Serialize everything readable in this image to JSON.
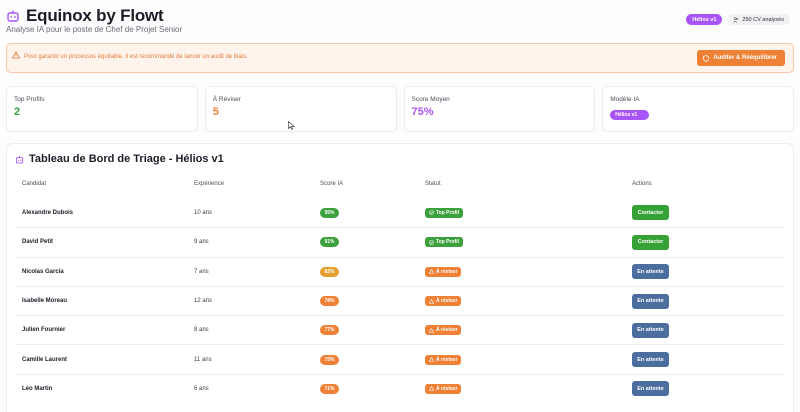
{
  "header": {
    "title": "Equinox by Flowt",
    "subtitle": "Analyse IA pour le poste de Chef de Projet Senior",
    "model_badge": "Hélios v1",
    "cv_count": "250 CV analysés"
  },
  "alert": {
    "text": "Pour garantir un processus équitable, il est recommandé de lancer un audit de biais.",
    "button_label": "Auditer & Rééquilibrer"
  },
  "stats": [
    {
      "label": "Top Profils",
      "value": "2",
      "color": "#3ca13c"
    },
    {
      "label": "À Réviser",
      "value": "5",
      "color": "#ee8135"
    },
    {
      "label": "Score Moyen",
      "value": "75%",
      "color": "#a855f7"
    },
    {
      "label": "Modèle IA",
      "value": "Hélios v1",
      "color": "#a855f7"
    }
  ],
  "board": {
    "title": "Tableau de Bord de Triage - Hélios v1",
    "columns": {
      "candidate": "Candidat",
      "experience": "Expérience",
      "score": "Score IA",
      "status": "Statut",
      "actions": "Actions"
    },
    "rows": [
      {
        "name": "Alexandre Dubois",
        "exp": "10 ans",
        "score": "95%",
        "score_color": "#3ca13c",
        "status": "Top Profil",
        "status_kind": "top",
        "action": "Contacter",
        "action_kind": "contact"
      },
      {
        "name": "David Petit",
        "exp": "9 ans",
        "score": "91%",
        "score_color": "#3ca13c",
        "status": "Top Profil",
        "status_kind": "top",
        "action": "Contacter",
        "action_kind": "contact"
      },
      {
        "name": "Nicolas Garcia",
        "exp": "7 ans",
        "score": "82%",
        "score_color": "#e3a02e",
        "status": "À réviser",
        "status_kind": "rev",
        "action": "En attente",
        "action_kind": "wait"
      },
      {
        "name": "Isabelle Moreau",
        "exp": "12 ans",
        "score": "78%",
        "score_color": "#ee8135",
        "status": "À réviser",
        "status_kind": "rev",
        "action": "En attente",
        "action_kind": "wait"
      },
      {
        "name": "Julien Fournier",
        "exp": "8 ans",
        "score": "77%",
        "score_color": "#ee8135",
        "status": "À réviser",
        "status_kind": "rev",
        "action": "En attente",
        "action_kind": "wait"
      },
      {
        "name": "Camille Laurent",
        "exp": "11 ans",
        "score": "75%",
        "score_color": "#ee8135",
        "status": "À réviser",
        "status_kind": "rev",
        "action": "En attente",
        "action_kind": "wait"
      },
      {
        "name": "Léo Martin",
        "exp": "6 ans",
        "score": "71%",
        "score_color": "#ee8135",
        "status": "À réviser",
        "status_kind": "rev",
        "action": "En attente",
        "action_kind": "wait"
      }
    ]
  }
}
